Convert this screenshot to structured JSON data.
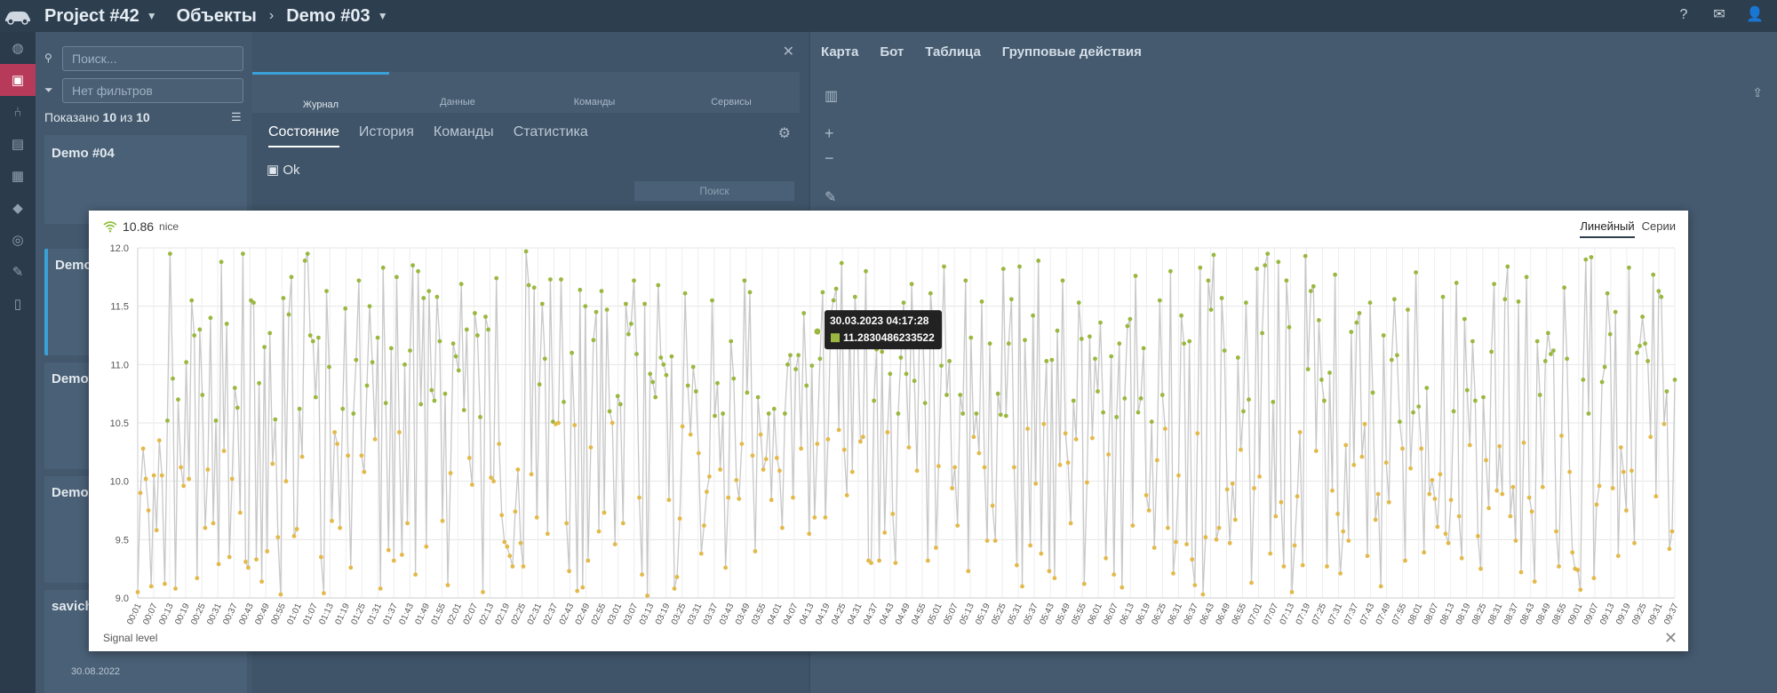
{
  "topbar": {
    "project": "Project #42",
    "section": "Объекты",
    "object": "Demo #03"
  },
  "rail": {
    "icons": [
      "globe-icon",
      "object-icon",
      "tree-icon",
      "calendar-icon",
      "table-icon",
      "tag-icon",
      "eye-off-icon",
      "edit-icon",
      "file-icon"
    ]
  },
  "listpanel": {
    "search_placeholder": "Поиск...",
    "filter_placeholder": "Нет фильтров",
    "shown_label": "Показано",
    "shown_count": "10",
    "shown_of": "из",
    "shown_total": "10",
    "items": [
      {
        "title": "Demo #04"
      },
      {
        "title": "Demo"
      },
      {
        "title": "Demo"
      },
      {
        "title": "Demo"
      },
      {
        "title": "savich"
      }
    ],
    "last_date": "30.08.2022"
  },
  "midpanel": {
    "tabs": [
      "Журнал",
      "Данные",
      "Команды",
      "Сервисы"
    ],
    "subtabs": [
      "Состояние",
      "История",
      "Команды",
      "Статистика"
    ],
    "status": "Ok",
    "search_placeholder": "Поиск"
  },
  "rightpanel": {
    "tabs": [
      "Карта",
      "Бот",
      "Таблица",
      "Групповые действия"
    ]
  },
  "modal": {
    "value": "10.86",
    "state": "nice",
    "view_tabs": [
      "Линейный",
      "Серии"
    ],
    "footer_label": "Signal level",
    "tooltip": {
      "date": "30.03.2023 04:17:28",
      "value": "11.2830486233522"
    }
  },
  "chart_data": {
    "type": "line",
    "ylim": [
      9.0,
      12.0
    ],
    "yticks": [
      "12.0",
      "11.5",
      "11.0",
      "10.5",
      "10.0",
      "9.5",
      "9.0"
    ],
    "xticks": [
      "00:01",
      "00:07",
      "00:13",
      "00:19",
      "00:25",
      "00:31",
      "00:37",
      "00:43",
      "00:49",
      "00:55",
      "01:01",
      "01:07",
      "01:13",
      "01:19",
      "01:25",
      "01:31",
      "01:37",
      "01:43",
      "01:49",
      "01:55",
      "02:01",
      "02:07",
      "02:13",
      "02:19",
      "02:25",
      "02:31",
      "02:37",
      "02:43",
      "02:49",
      "02:55",
      "03:01",
      "03:07",
      "03:13",
      "03:19",
      "03:25",
      "03:31",
      "03:37",
      "03:43",
      "03:49",
      "03:55",
      "04:01",
      "04:07",
      "04:13",
      "04:19",
      "04:25",
      "04:31",
      "04:37",
      "04:43",
      "04:49",
      "04:55",
      "05:01",
      "05:07",
      "05:13",
      "05:19",
      "05:25",
      "05:31",
      "05:37",
      "05:43",
      "05:49",
      "05:55",
      "06:01",
      "06:07",
      "06:13",
      "06:19",
      "06:25",
      "06:31",
      "06:37",
      "06:43",
      "06:49",
      "06:55",
      "07:01",
      "07:07",
      "07:13",
      "07:19",
      "07:25",
      "07:31",
      "07:37",
      "07:43",
      "07:49",
      "07:55",
      "08:01",
      "08:07",
      "08:13",
      "08:19",
      "08:25",
      "08:31",
      "08:37",
      "08:43",
      "08:49",
      "08:55",
      "09:01",
      "09:07",
      "09:13",
      "09:19",
      "09:25",
      "09:31",
      "09:37"
    ],
    "series": [
      {
        "values": [
          9.05,
          9.9,
          10.28,
          10.02,
          9.75,
          9.1,
          10.05,
          9.58,
          10.35,
          10.05,
          9.12,
          10.52,
          11.95,
          10.88,
          9.08,
          10.7,
          10.12,
          9.96,
          11.02,
          10.02,
          11.55,
          11.25,
          9.17,
          11.3,
          10.74,
          9.6,
          10.1,
          11.4,
          9.64,
          10.52,
          9.29,
          11.88,
          10.26,
          11.35,
          9.35,
          10.02,
          10.8,
          10.63,
          9.73,
          11.95,
          9.31,
          9.26,
          11.55,
          11.53,
          9.33,
          10.84,
          9.14,
          11.15,
          9.4,
          11.27,
          10.15,
          10.53,
          9.52,
          9.03,
          11.57,
          10.0,
          11.43,
          11.75,
          9.53,
          9.59,
          10.62,
          10.21,
          11.89,
          11.95,
          11.25,
          11.2,
          10.72,
          11.23,
          9.35,
          9.04,
          11.63,
          10.98,
          9.66,
          10.42,
          10.32,
          9.6,
          10.62,
          11.48,
          10.22,
          9.26,
          10.58,
          11.04,
          11.72,
          10.22,
          10.08,
          10.82,
          11.5,
          11.02,
          10.36,
          11.23,
          9.08,
          11.83,
          10.67,
          9.41,
          11.14,
          9.32,
          11.75,
          10.42,
          9.37,
          11.0,
          9.64,
          11.12,
          11.85,
          9.2,
          11.8,
          10.66,
          11.57,
          9.44,
          11.63,
          10.78,
          10.69,
          11.58,
          11.2,
          9.66,
          10.75,
          9.11,
          10.07,
          11.18,
          11.07,
          10.95,
          11.69,
          10.61,
          11.3,
          10.2,
          9.97,
          11.44,
          11.25,
          10.55,
          9.05,
          11.41,
          11.3,
          10.03,
          10.0,
          11.74,
          10.32,
          9.71,
          9.48,
          9.44,
          9.36,
          9.27,
          9.74,
          10.1,
          9.47,
          9.27,
          11.97,
          11.68,
          10.06,
          11.66,
          9.69,
          10.83,
          11.52,
          11.05,
          9.55,
          11.73,
          10.51,
          10.49,
          10.5,
          11.73,
          10.68,
          9.64,
          9.23,
          11.1,
          10.48,
          9.06,
          11.64,
          9.09,
          11.5,
          9.32,
          10.29,
          11.21,
          11.45,
          9.57,
          11.63,
          9.73,
          11.47,
          10.6,
          10.5,
          9.46,
          10.73,
          10.66,
          9.64,
          11.52,
          11.26,
          11.35,
          11.72,
          11.09,
          9.86,
          9.2,
          11.52,
          9.02,
          10.92,
          10.85,
          10.72,
          11.68,
          11.06,
          11.0,
          10.91,
          9.84,
          11.07,
          9.08,
          9.18,
          9.68,
          10.47,
          11.61,
          10.82,
          10.4,
          10.98,
          10.77,
          10.24,
          9.38,
          9.62,
          9.91,
          10.04,
          11.55,
          10.56,
          10.84,
          10.1,
          10.58,
          9.26,
          9.86,
          11.2,
          10.88,
          10.01,
          9.85,
          10.32,
          11.72,
          10.76,
          11.62,
          10.22,
          9.4,
          10.72,
          10.4,
          10.1,
          10.19,
          10.58,
          9.84,
          10.62,
          10.2,
          10.09,
          9.6,
          10.58,
          11.0,
          11.08,
          9.86,
          10.96,
          11.08,
          10.28,
          11.44,
          10.82,
          9.55,
          10.99,
          9.69,
          10.32,
          11.05,
          11.62,
          9.69,
          10.36,
          11.42,
          11.55,
          11.65,
          10.44,
          11.87,
          10.27,
          9.88,
          11.43,
          10.08,
          11.58,
          11.18,
          10.34,
          10.38,
          11.8,
          9.32,
          9.3,
          10.69,
          11.13,
          9.32,
          11.11,
          9.56,
          10.42,
          10.92,
          9.72,
          9.3,
          10.58,
          11.06,
          11.53,
          10.92,
          10.29,
          11.69,
          10.86,
          10.09,
          11.43,
          11.38,
          10.67,
          9.32,
          11.61,
          11.3,
          9.43,
          10.13,
          10.99,
          11.84,
          10.74,
          11.03,
          9.94,
          10.12,
          9.62,
          10.74,
          10.58,
          11.72,
          9.23,
          11.23,
          10.38,
          10.58,
          10.24,
          11.54,
          10.12,
          9.49,
          11.18,
          9.79,
          9.49,
          10.75,
          10.57,
          11.82,
          10.56,
          11.18,
          11.56,
          10.12,
          9.28,
          11.84,
          9.1,
          11.21,
          10.45,
          9.45,
          11.42,
          9.98,
          11.89,
          9.38,
          10.49,
          11.03,
          9.23,
          11.04,
          9.17,
          11.29,
          10.14,
          11.72,
          10.41,
          10.16,
          9.64,
          10.69,
          10.36,
          11.53,
          11.22,
          9.12,
          9.99,
          11.24,
          10.37,
          11.05,
          10.77,
          11.36,
          10.59,
          9.34,
          10.23,
          11.07,
          9.2,
          10.55,
          11.18,
          9.09,
          10.71,
          11.33,
          11.39,
          9.62,
          11.76,
          10.59,
          10.71,
          11.14,
          9.88,
          9.75,
          10.51,
          9.43,
          10.18,
          11.55,
          10.74,
          10.45,
          9.6,
          11.8,
          9.21,
          9.48,
          10.05,
          11.42,
          11.18,
          9.46,
          11.2,
          9.33,
          9.11,
          10.41,
          11.83,
          9.03,
          9.52,
          11.72,
          11.47,
          11.94,
          9.5,
          9.6,
          11.57,
          11.12,
          9.93,
          9.47,
          9.98,
          9.67,
          11.06,
          10.27,
          10.6,
          11.53,
          10.7,
          9.13,
          9.94,
          11.82,
          10.04,
          11.27,
          11.85,
          11.95,
          9.38,
          10.68,
          9.7,
          11.88,
          9.82,
          9.27,
          11.72,
          11.32,
          9.05,
          9.45,
          9.87,
          10.42,
          9.28,
          11.93,
          10.96,
          11.63,
          11.67,
          10.26,
          11.38,
          10.87,
          10.69,
          9.27,
          10.93,
          9.92,
          11.77,
          9.72,
          9.21,
          9.57,
          10.31,
          9.49,
          11.28,
          10.14,
          11.36,
          11.44,
          10.21,
          10.49,
          9.36,
          11.53,
          10.76,
          9.67,
          9.89,
          9.1,
          11.25,
          10.16,
          9.82,
          11.04,
          11.56,
          11.08,
          10.51,
          10.28,
          9.32,
          11.47,
          10.11,
          10.59,
          11.79,
          10.64,
          10.28,
          9.39,
          10.8,
          9.89,
          10.01,
          9.85,
          9.61,
          10.06,
          11.58,
          9.55,
          9.47,
          9.84,
          10.6,
          11.7,
          9.7,
          9.34,
          11.39,
          10.78,
          10.31,
          11.2,
          10.69,
          9.53,
          9.25,
          10.72,
          10.18,
          9.77,
          11.11,
          11.69,
          9.92,
          10.3,
          9.89,
          11.56,
          11.84,
          9.7,
          9.95,
          9.49,
          11.54,
          9.22,
          10.33,
          11.75,
          9.86,
          9.74,
          9.14,
          11.2,
          10.74,
          9.95,
          11.03,
          11.27,
          11.09,
          11.12,
          9.57,
          9.27,
          10.39,
          11.66,
          11.05,
          10.08,
          9.39,
          9.25,
          9.24,
          9.07,
          10.87,
          11.9,
          10.58,
          11.92,
          9.17,
          9.8,
          9.96,
          10.85,
          10.98,
          11.61,
          11.26,
          9.94,
          11.45,
          9.36,
          10.29,
          10.08,
          9.75,
          11.83,
          10.09,
          9.47,
          11.1,
          11.16,
          11.41,
          11.18,
          11.03,
          10.38,
          11.77,
          9.87,
          11.63,
          11.58,
          10.49,
          10.77,
          9.42,
          9.57,
          10.87
        ],
        "color": "#c8c8c8"
      }
    ]
  }
}
